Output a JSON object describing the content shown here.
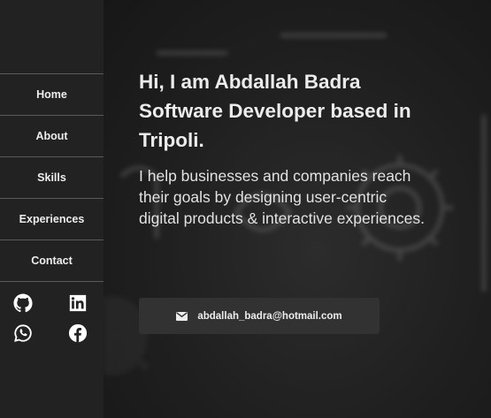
{
  "sidebar": {
    "nav": [
      {
        "label": "Home"
      },
      {
        "label": "About"
      },
      {
        "label": "Skills"
      },
      {
        "label": "Experiences"
      },
      {
        "label": "Contact"
      }
    ],
    "socials": [
      {
        "icon": "github-icon"
      },
      {
        "icon": "linkedin-icon"
      },
      {
        "icon": "whatsapp-icon"
      },
      {
        "icon": "facebook-icon"
      }
    ]
  },
  "hero": {
    "headline": [
      "Hi, I am Abdallah Badra",
      "Software Developer based in",
      "Tripoli."
    ],
    "tagline": [
      "I help businesses and companies reach",
      "their goals by designing user-centric",
      "digital products & interactive experiences."
    ],
    "email": "abdallah_badra@hotmail.com",
    "email_icon": "envelope-icon"
  },
  "colors": {
    "sidebar_bg": "#222222",
    "text": "#ececec",
    "button_bg": "#323232"
  }
}
